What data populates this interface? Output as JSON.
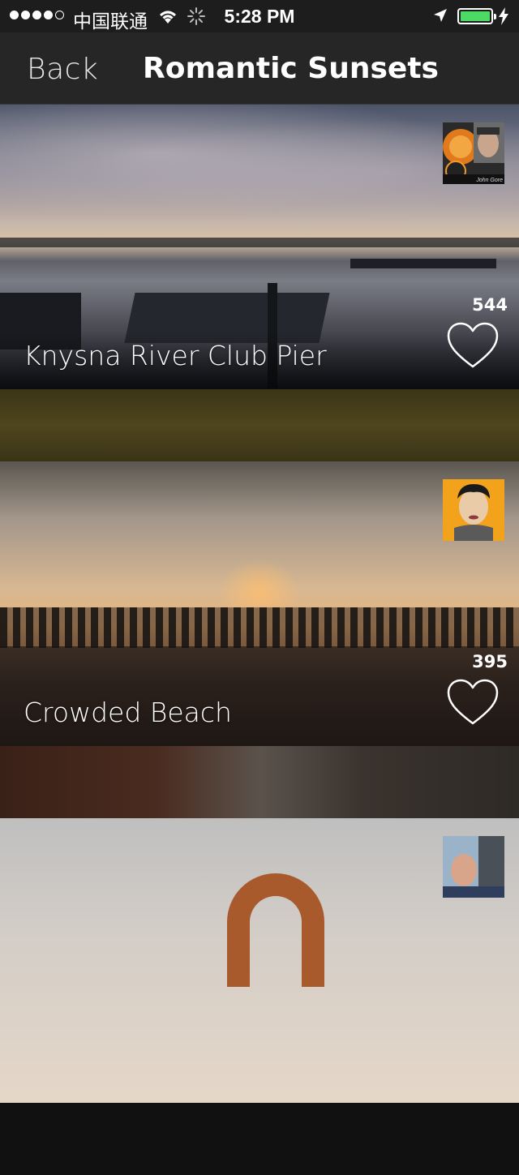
{
  "status_bar": {
    "carrier": "中国联通",
    "time": "5:28 PM"
  },
  "nav": {
    "back_label": "Back",
    "title": "Romantic Sunsets"
  },
  "cards": [
    {
      "title": "Knysna River Club Pier",
      "likes": "544",
      "avatar_caption": "John Gore"
    },
    {
      "title": "Crowded Beach",
      "likes": "395",
      "avatar_caption": ""
    },
    {
      "title": "",
      "likes": "",
      "avatar_caption": ""
    }
  ],
  "colors": {
    "nav_background": "#262626",
    "battery_green": "#4cd964"
  }
}
